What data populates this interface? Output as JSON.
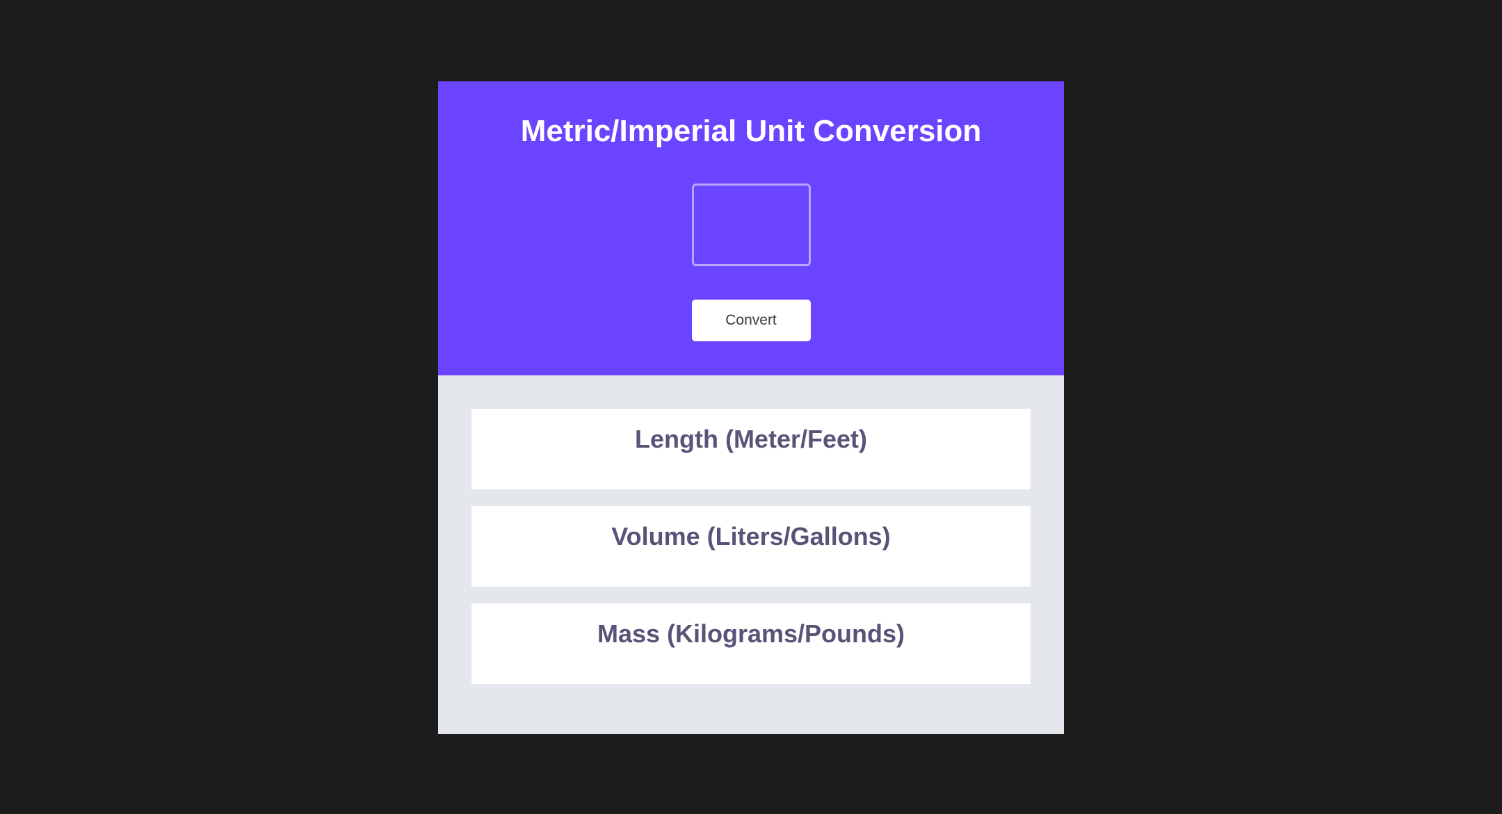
{
  "header": {
    "title": "Metric/Imperial Unit Conversion",
    "input": {
      "value": "",
      "placeholder": ""
    },
    "convert_label": "Convert"
  },
  "results": [
    {
      "title": "Length (Meter/Feet)",
      "text": ""
    },
    {
      "title": "Volume (Liters/Gallons)",
      "text": ""
    },
    {
      "title": "Mass (Kilograms/Pounds)",
      "text": ""
    }
  ],
  "colors": {
    "background": "#1c1c1c",
    "header": "#6b44ff",
    "panel": "#e4e7eb",
    "card": "#ffffff",
    "card_text": "#5a5277"
  }
}
